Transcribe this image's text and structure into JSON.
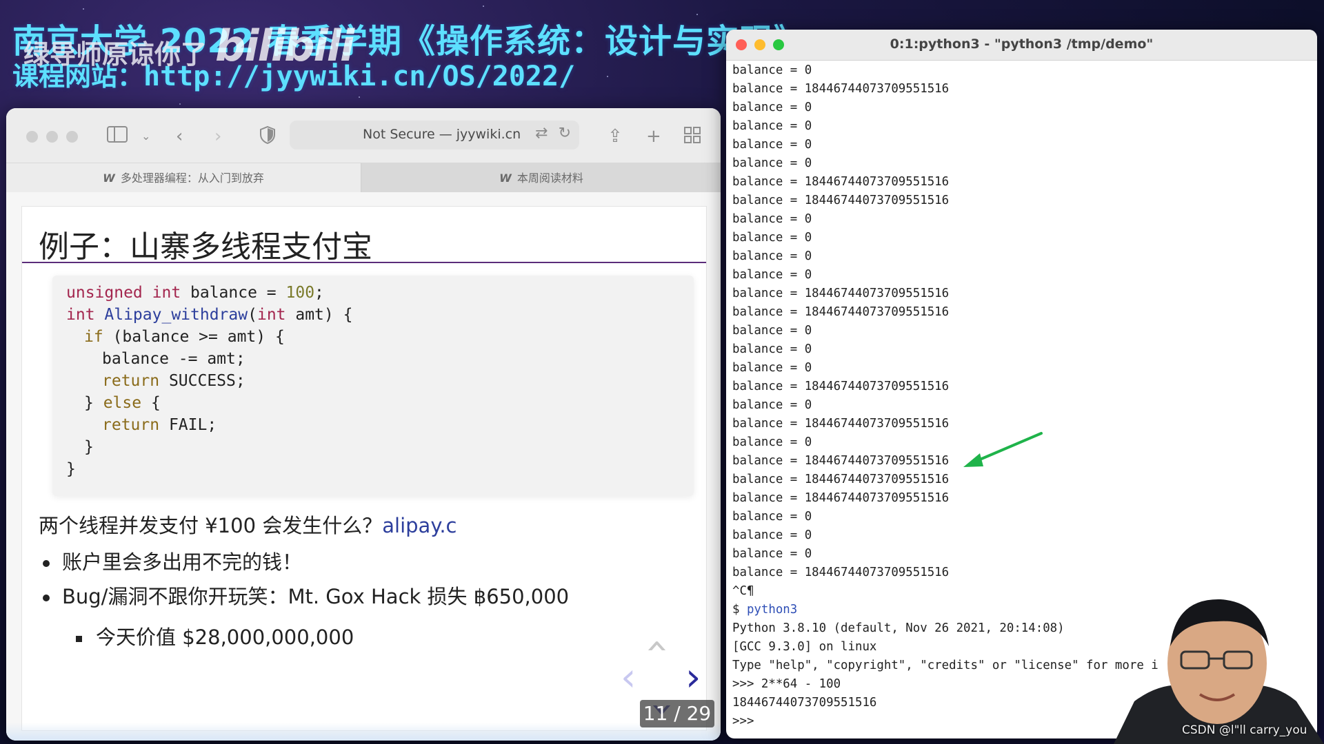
{
  "overlay": {
    "headline": "南京大学 2022 春季学期《操作系统：设计与实现》",
    "course_site_prefix": "课程网站：",
    "course_site_url": "http://jyywiki.cn/OS/2022/",
    "danmaku": "绿导师原谅你了",
    "video_logo": "bilibili",
    "watermark": "CSDN @l\"ll  carry_you"
  },
  "browser": {
    "url_text": "Not Secure — jyywiki.cn",
    "tabs": [
      {
        "icon": "wiki-icon",
        "label": "多处理器编程：从入门到放弃"
      },
      {
        "icon": "wiki-icon",
        "label": "本周阅读材料"
      }
    ]
  },
  "slide": {
    "title": "例子：山寨多线程支付宝",
    "question_text": "两个线程并发支付 ¥100 会发生什么？",
    "question_link": "alipay.c",
    "bullets": [
      "账户里会多出用不完的钱！",
      "Bug/漏洞不跟你开玩笑：Mt. Gox Hack 损失 ฿650,000"
    ],
    "sub_bullet": "今天价值 $28,000,000,000",
    "page_counter": "11 / 29",
    "code_tokens": {
      "l1_kw": "unsigned int",
      "l1_rest": " balance = ",
      "l1_num": "100",
      "l1_end": ";",
      "l2_kw": "int",
      "l2_fn": " Alipay_withdraw",
      "l2_rest_a": "(",
      "l2_kw2": "int",
      "l2_rest_b": " amt) {",
      "l3_kw": "if",
      "l3_rest": " (balance >= amt) {",
      "l4_text": "balance -= amt;",
      "l5_kw": "return",
      "l5_rest": " SUCCESS;",
      "l6_open": "} ",
      "l6_kw": "else",
      "l6_rest": " {",
      "l7_kw": "return",
      "l7_rest": " FAIL;",
      "l8": "}",
      "l9": "}"
    }
  },
  "terminal": {
    "title": "0:1:python3 - \"python3 /tmp/demo\"",
    "lines": [
      "balance = 0",
      "balance = 18446744073709551516",
      "balance = 0",
      "balance = 0",
      "balance = 0",
      "balance = 0",
      "balance = 18446744073709551516",
      "balance = 18446744073709551516",
      "balance = 0",
      "balance = 0",
      "balance = 0",
      "balance = 0",
      "balance = 18446744073709551516",
      "balance = 18446744073709551516",
      "balance = 0",
      "balance = 0",
      "balance = 0",
      "balance = 18446744073709551516",
      "balance = 0",
      "balance = 18446744073709551516",
      "balance = 0",
      "balance = 18446744073709551516",
      "balance = 18446744073709551516",
      "balance = 18446744073709551516",
      "balance = 0",
      "balance = 0",
      "balance = 0",
      "balance = 18446744073709551516",
      "^C¶",
      "$ python3",
      "Python 3.8.10 (default, Nov 26 2021, 20:14:08)",
      "[GCC 9.3.0] on linux",
      "Type \"help\", \"copyright\", \"credits\" or \"license\" for more i",
      ">>> 2**64 - 100",
      "18446744073709551516",
      ">>>"
    ]
  },
  "colors": {
    "overlay_text": "#5de0ff",
    "arrow": "#1fb34a",
    "slide_rule": "#5b2c7a",
    "link": "#2c3e9c",
    "nav_up": "#c8c8c8",
    "nav_left": "#c8c8f0",
    "nav_right": "#2a2a9a"
  }
}
